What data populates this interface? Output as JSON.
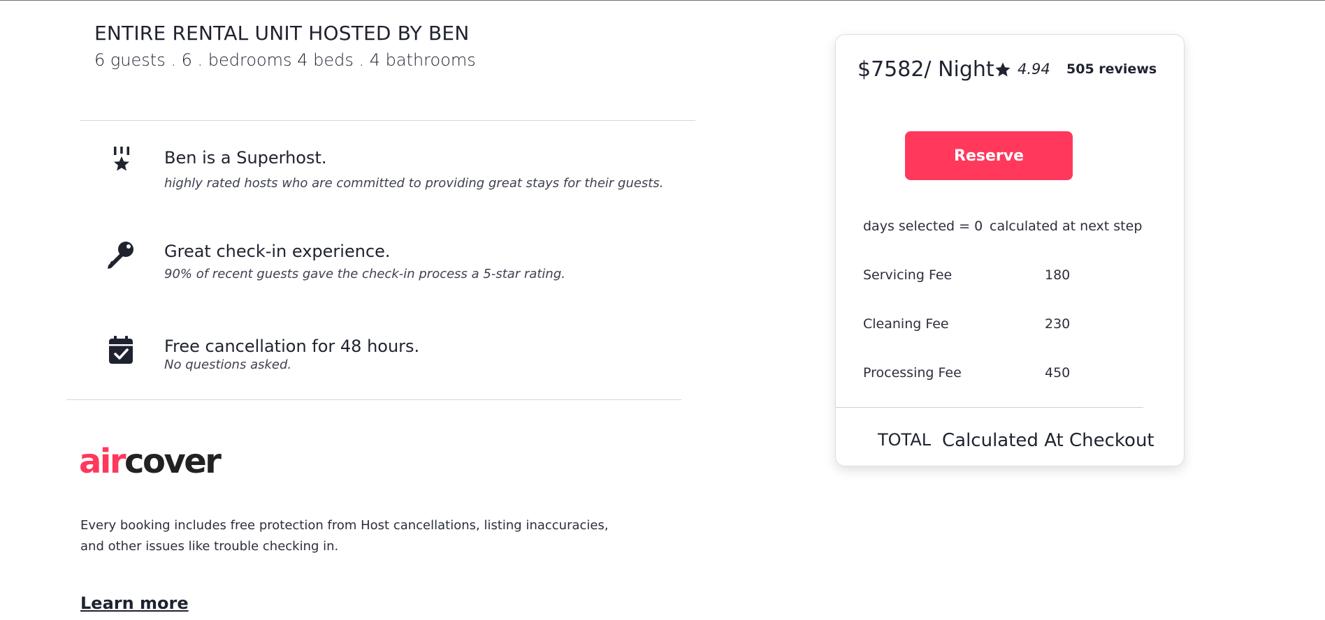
{
  "listing": {
    "title": "ENTIRE RENTAL UNIT HOSTED BY BEN",
    "summary": "6 guests . 6 . bedrooms 4 beds . 4 bathrooms"
  },
  "features": [
    {
      "icon": "superhost-medal-icon",
      "title": "Ben is a Superhost.",
      "description": "highly rated hosts who are committed to providing great stays for their guests."
    },
    {
      "icon": "key-icon",
      "title": "Great check-in experience.",
      "description": "90% of recent guests gave the check-in process a 5-star rating."
    },
    {
      "icon": "calendar-check-icon",
      "title": "Free cancellation for 48 hours.",
      "description": "No questions asked."
    }
  ],
  "aircover": {
    "logo_air": "air",
    "logo_cover": "cover",
    "description": "Every booking includes free protection from Host cancellations, listing inaccuracies, and other issues like trouble checking in.",
    "learn_more": "Learn more"
  },
  "booking": {
    "price": "$7582/ Night",
    "rating": "4.94",
    "reviews": "505 reviews",
    "reserve_label": "Reserve",
    "days_label": "days selected = 0",
    "days_value": "calculated at next step",
    "fees": [
      {
        "label": "Servicing Fee",
        "value": "180"
      },
      {
        "label": "Cleaning Fee",
        "value": "230"
      },
      {
        "label": "Processing Fee",
        "value": "450"
      }
    ],
    "total_label": "TOTAL",
    "total_value": "Calculated At Checkout"
  },
  "colors": {
    "brand": "#ff385c",
    "text": "#1f2330"
  }
}
